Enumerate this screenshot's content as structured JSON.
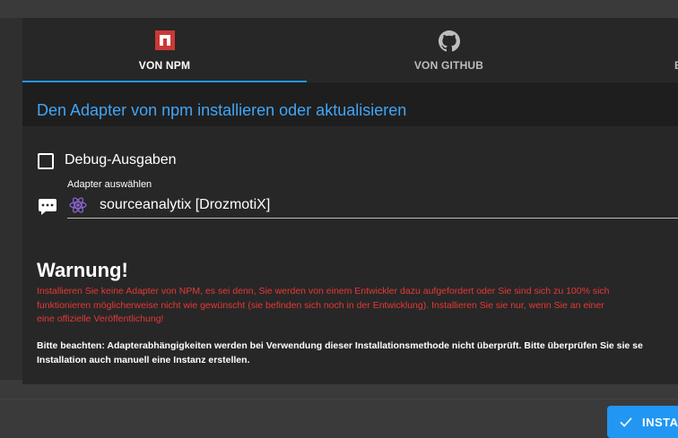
{
  "colors": {
    "accent": "#2196f3",
    "link_title": "#42a5f5",
    "warning": "#e53935",
    "npm_brand": "#cb3837"
  },
  "tabs": [
    {
      "label": "VON NPM",
      "icon": "npm-icon",
      "selected": true
    },
    {
      "label": "VON GITHUB",
      "icon": "github-icon",
      "selected": false
    },
    {
      "label": "B",
      "icon": "",
      "selected": false
    }
  ],
  "panel": {
    "title": "Den Adapter von npm installieren oder aktualisieren",
    "debug_label": "Debug-Ausgaben",
    "debug_checked": false,
    "adapter_field": {
      "label": "Adapter auswählen",
      "value": "sourceanalytix [DrozmotiX]",
      "icon": "react-icon"
    },
    "warning": {
      "title": "Warnung!",
      "text_line1": "Installieren Sie keine Adapter von NPM, es sei denn, Sie werden von einem Entwickler dazu aufgefordert oder Sie sind sich zu 100% sich",
      "text_line2": "funktionieren möglicherweise nicht wie gewünscht (sie befinden sich noch in der Entwicklung). Installieren Sie sie nur, wenn Sie an einer",
      "text_line3": "eine offizielle Veröffentlichung!"
    },
    "note": {
      "line1": "Bitte beachten: Adapterabhängigkeiten werden bei Verwendung dieser Installationsmethode nicht überprüft. Bitte überprüfen Sie sie se",
      "line2": "Installation auch manuell eine Instanz erstellen."
    }
  },
  "footer": {
    "install_label": "INSTA"
  }
}
